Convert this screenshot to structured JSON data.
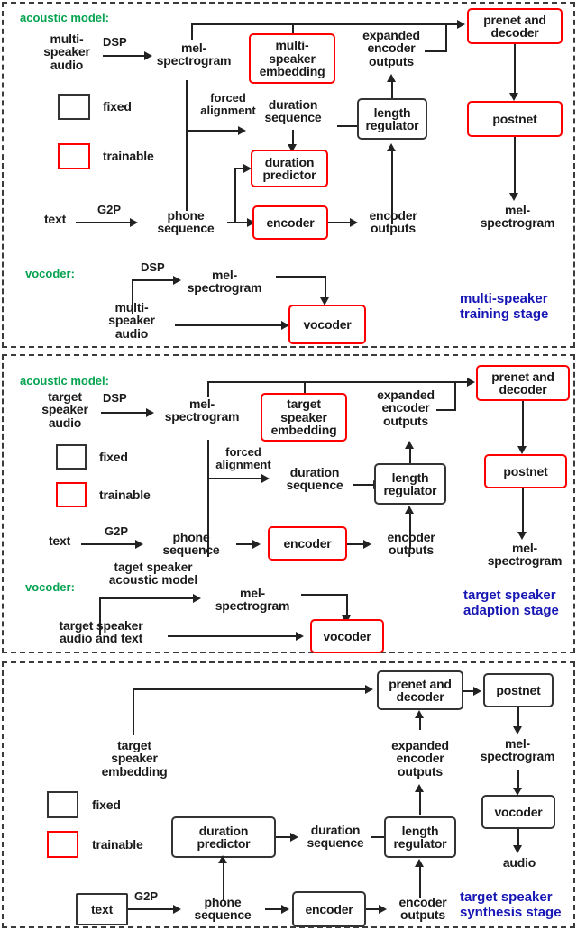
{
  "figure": {
    "title": "Three-stage multi-speaker TTS adaptation pipeline",
    "colors": {
      "section_green": "#06a350",
      "stage_blue": "#1616b4",
      "trainable_red": "#ff0000",
      "fixed_black": "#333333",
      "panel_border": "#3b3b3b"
    }
  },
  "panels": [
    {
      "id": "training",
      "section_acoustic": "acoustic model:",
      "section_vocoder": "vocoder:",
      "stage_label_line1": "multi-speaker",
      "stage_label_line2": "training stage",
      "legend": [
        {
          "kind": "fixed",
          "label": "fixed"
        },
        {
          "kind": "trainable",
          "label": "trainable"
        }
      ],
      "nodes": {
        "audio": "multi-\nspeaker\naudio",
        "mel": "mel-\nspectrogram",
        "embedding": "multi-\nspeaker\nembedding",
        "expanded": "expanded\nencoder\noutputs",
        "prenet": "prenet and\ndecoder",
        "postnet": "postnet",
        "mel_out": "mel-\nspectrogram",
        "duration_sequence": "duration\nsequence",
        "length_regulator": "length\nregulator",
        "duration_predictor": "duration\npredictor",
        "text": "text",
        "phone": "phone\nsequence",
        "encoder": "encoder",
        "encoder_outputs": "encoder\noutputs",
        "voc_mel": "mel-\nspectrogram",
        "voc_audio": "multi-\nspeaker\naudio",
        "vocoder": "vocoder"
      },
      "edges": {
        "dsp": "DSP",
        "forced_alignment": "forced\nalignment",
        "g2p": "G2P",
        "voc_dsp": "DSP"
      }
    },
    {
      "id": "adaption",
      "section_acoustic": "acoustic model:",
      "section_vocoder": "vocoder:",
      "stage_label_line1": "target speaker",
      "stage_label_line2": "adaption stage",
      "legend": [
        {
          "kind": "fixed",
          "label": "fixed"
        },
        {
          "kind": "trainable",
          "label": "trainable"
        }
      ],
      "nodes": {
        "audio": "target\nspeaker\naudio",
        "mel": "mel-\nspectrogram",
        "embedding": "target\nspeaker\nembedding",
        "expanded": "expanded\nencoder\noutputs",
        "prenet": "prenet and\ndecoder",
        "postnet": "postnet",
        "mel_out": "mel-\nspectrogram",
        "duration_sequence": "duration\nsequence",
        "length_regulator": "length\nregulator",
        "text": "text",
        "phone": "phone\nsequence",
        "encoder": "encoder",
        "encoder_outputs": "encoder\noutputs",
        "voc_mel": "mel-\nspectrogram",
        "voc_audio": "target speaker\naudio and text",
        "vocoder": "vocoder"
      },
      "edges": {
        "dsp": "DSP",
        "forced_alignment": "forced\nalignment",
        "g2p": "G2P",
        "voc_model": "taget speaker\nacoustic model"
      }
    },
    {
      "id": "synthesis",
      "stage_label_line1": "target speaker",
      "stage_label_line2": "synthesis stage",
      "legend": [
        {
          "kind": "fixed",
          "label": "fixed"
        },
        {
          "kind": "trainable",
          "label": "trainable"
        }
      ],
      "nodes": {
        "embedding": "target\nspeaker\nembedding",
        "prenet": "prenet and\ndecoder",
        "postnet": "postnet",
        "mel_out": "mel-\nspectrogram",
        "vocoder": "vocoder",
        "audio_out": "audio",
        "expanded": "expanded\nencoder\noutputs",
        "duration_predictor": "duration\npredictor",
        "duration_sequence": "duration\nsequence",
        "length_regulator": "length\nregulator",
        "text": "text",
        "phone": "phone\nsequence",
        "encoder": "encoder",
        "encoder_outputs": "encoder\noutputs"
      },
      "edges": {
        "g2p": "G2P"
      }
    }
  ]
}
